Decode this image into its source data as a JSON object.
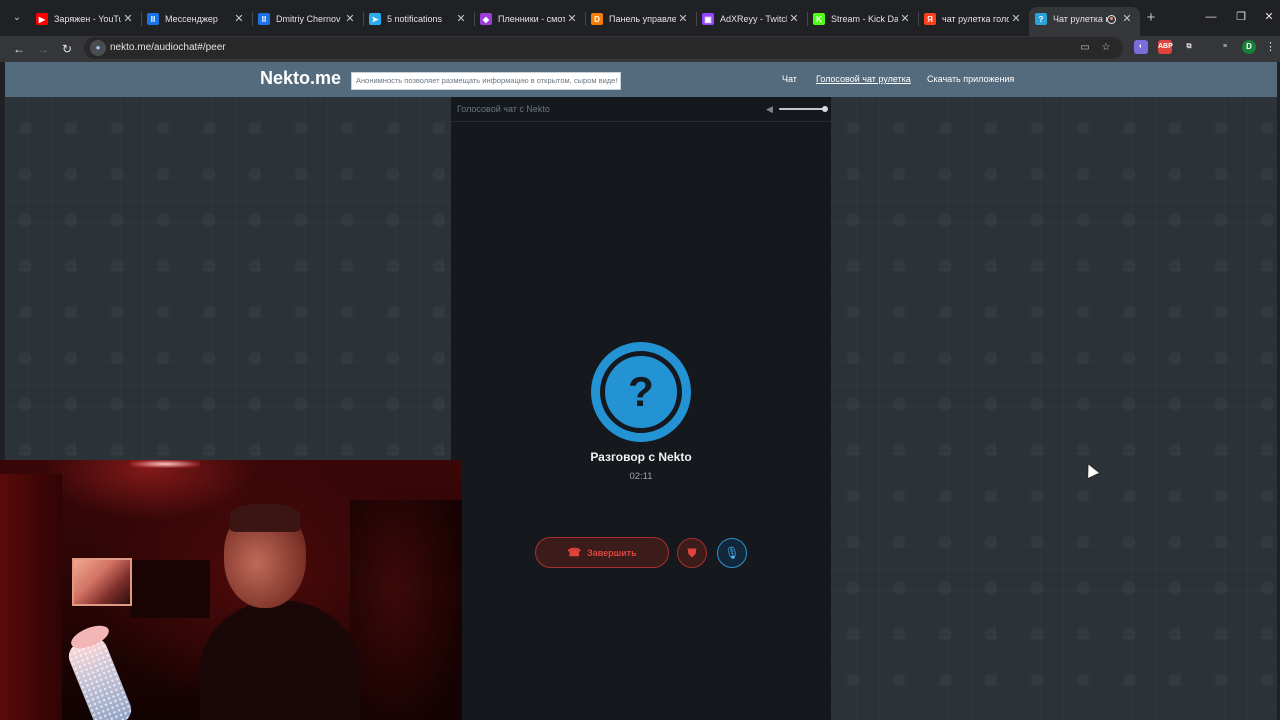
{
  "browser": {
    "tabs": [
      {
        "title": "Заряжен - YouTube",
        "favicon": "youtube-icon",
        "color": "#ff0000",
        "glyph": "▶"
      },
      {
        "title": "Мессенджер",
        "favicon": "messenger-icon",
        "color": "#1a73e8",
        "glyph": "II"
      },
      {
        "title": "Dmitriy Chernov",
        "favicon": "messenger-icon",
        "color": "#1a73e8",
        "glyph": "II"
      },
      {
        "title": "5 notifications",
        "favicon": "telegram-icon",
        "color": "#2aabee",
        "glyph": "➤"
      },
      {
        "title": "Пленники - смотр",
        "favicon": "kinopoisk-icon",
        "color": "#9b3fd6",
        "glyph": "◆"
      },
      {
        "title": "Панель управлен",
        "favicon": "donationalerts-icon",
        "color": "#f57d07",
        "glyph": "D"
      },
      {
        "title": "AdXReyy - Twitch",
        "favicon": "twitch-icon",
        "color": "#9146ff",
        "glyph": "▣"
      },
      {
        "title": "Stream - Kick Das",
        "favicon": "kick-icon",
        "color": "#53fc18",
        "glyph": "K"
      },
      {
        "title": "чат рулетка голо",
        "favicon": "yandex-icon",
        "color": "#fc3f1d",
        "glyph": "Я"
      },
      {
        "title": "Чат рулетка г",
        "favicon": "nekto-icon",
        "color": "#2aa3d8",
        "glyph": "?",
        "active": true
      }
    ],
    "url": "nekto.me/audiochat#/peer"
  },
  "site": {
    "logo": "Nekto.me",
    "tagline": "Анонимность позволяет размещать информацию в открытом, сыром виде!",
    "nav": [
      {
        "label": "Чат"
      },
      {
        "label": "Голосовой чат рулетка",
        "current": true
      },
      {
        "label": "Скачать приложения"
      }
    ]
  },
  "chat": {
    "panel_title": "Голосовой чат с Nekto",
    "volume_fraction": 1.0,
    "avatar_glyph": "?",
    "peer_name": "Разговор с Nekto",
    "timer": "02:11",
    "end_button_label": "Завершить"
  },
  "colors": {
    "header": "#546b7e",
    "panel": "#15191d",
    "accent_blue": "#2393d3",
    "danger_red": "#e0443c"
  }
}
